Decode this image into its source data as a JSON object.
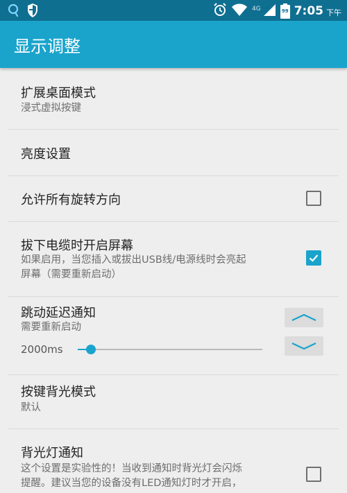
{
  "status_bar": {
    "time": "7:05",
    "ampm": "下午",
    "network_type": "4G",
    "battery_level": "99",
    "icons": [
      "app-notification-icon",
      "shield-icon",
      "alarm-icon",
      "wifi-icon",
      "signal-icon",
      "battery-icon"
    ]
  },
  "app_bar": {
    "title": "显示调整"
  },
  "colors": {
    "status_bar": "#0f6f91",
    "app_bar": "#1aa4cc",
    "accent": "#1aa4cc",
    "background": "#eeeeee"
  },
  "settings": {
    "expanded_desktop": {
      "title": "扩展桌面模式",
      "summary": "浸式虚拟按键"
    },
    "brightness": {
      "title": "亮度设置"
    },
    "rotation": {
      "title": "允许所有旋转方向",
      "checked": false
    },
    "unplug_wake": {
      "title": "拔下电缆时开启屏幕",
      "summary_line1": "如果启用，当您插入或拔出USB线/电源线时会亮起",
      "summary_line2": "屏幕（需要重新启动）",
      "checked": true
    },
    "bounce_delay": {
      "title": "跳动延迟通知",
      "summary": "需要重新启动",
      "value_label": "2000ms",
      "slider_fraction": 0.07
    },
    "key_backlight": {
      "title": "按键背光模式",
      "summary": "默认"
    },
    "backlight_notify": {
      "title": "背光灯通知",
      "summary_line1": "这个设置是实验性的！当收到通知时背光灯会闪烁",
      "summary_line2": "提醒。建议当您的设备没有LED通知灯时才开启，",
      "checked": false
    }
  }
}
